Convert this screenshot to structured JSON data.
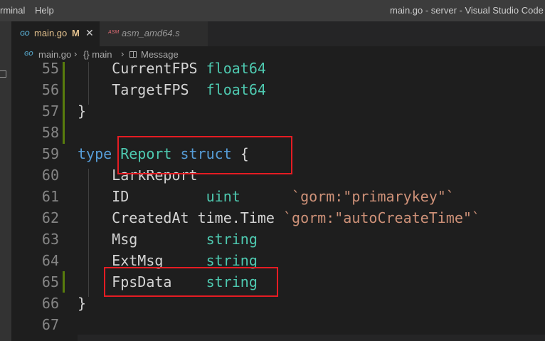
{
  "titlebar": {
    "menu_items": [
      "rminal",
      "Help"
    ],
    "title": "main.go - server - Visual Studio Code"
  },
  "tabs": [
    {
      "icon": "GO",
      "label": "main.go",
      "badge": "M",
      "close": "✕",
      "active": true
    },
    {
      "icon": "ASM",
      "label": "asm_amd64.s",
      "active": false
    }
  ],
  "breadcrumb": {
    "file_icon": "GO",
    "file": "main.go",
    "function": "{} main",
    "symbol": "Message",
    "separator": "›"
  },
  "editor": {
    "lines": [
      {
        "num": "55",
        "tokens": [
          {
            "t": "    CurrentFPS ",
            "c": "fld"
          },
          {
            "t": "float64",
            "c": "ty"
          }
        ]
      },
      {
        "num": "56",
        "tokens": [
          {
            "t": "    TargetFPS  ",
            "c": "fld"
          },
          {
            "t": "float64",
            "c": "ty"
          }
        ]
      },
      {
        "num": "57",
        "tokens": [
          {
            "t": "}",
            "c": "pun"
          }
        ]
      },
      {
        "num": "58",
        "tokens": []
      },
      {
        "num": "59",
        "tokens": [
          {
            "t": "type ",
            "c": "kw"
          },
          {
            "t": "Report",
            "c": "ty"
          },
          {
            "t": " ",
            "c": "pun"
          },
          {
            "t": "struct",
            "c": "kw"
          },
          {
            "t": " {",
            "c": "pun"
          }
        ]
      },
      {
        "num": "60",
        "tokens": [
          {
            "t": "    LarkReport",
            "c": "fld"
          }
        ]
      },
      {
        "num": "61",
        "tokens": [
          {
            "t": "    ID         ",
            "c": "fld"
          },
          {
            "t": "uint",
            "c": "ty"
          },
          {
            "t": "      ",
            "c": "pun"
          },
          {
            "t": "`gorm:\"primarykey\"`",
            "c": "str"
          }
        ]
      },
      {
        "num": "62",
        "tokens": [
          {
            "t": "    CreatedAt ",
            "c": "fld"
          },
          {
            "t": "time.Time",
            "c": "fld"
          },
          {
            "t": " ",
            "c": "pun"
          },
          {
            "t": "`gorm:\"autoCreateTime\"`",
            "c": "str"
          }
        ]
      },
      {
        "num": "63",
        "tokens": [
          {
            "t": "    Msg        ",
            "c": "fld"
          },
          {
            "t": "string",
            "c": "ty"
          }
        ]
      },
      {
        "num": "64",
        "tokens": [
          {
            "t": "    ExtMsg     ",
            "c": "fld"
          },
          {
            "t": "string",
            "c": "ty"
          }
        ]
      },
      {
        "num": "65",
        "tokens": [
          {
            "t": "    FpsData    ",
            "c": "fld"
          },
          {
            "t": "string",
            "c": "ty"
          }
        ]
      },
      {
        "num": "66",
        "tokens": [
          {
            "t": "}",
            "c": "pun"
          }
        ]
      },
      {
        "num": "67",
        "tokens": []
      }
    ]
  },
  "colors": {
    "highlight_box": "#e51c23",
    "gutter_modified": "#587c0c",
    "keyword": "#569cd6",
    "type": "#4ec9b0",
    "string": "#ce9178"
  }
}
